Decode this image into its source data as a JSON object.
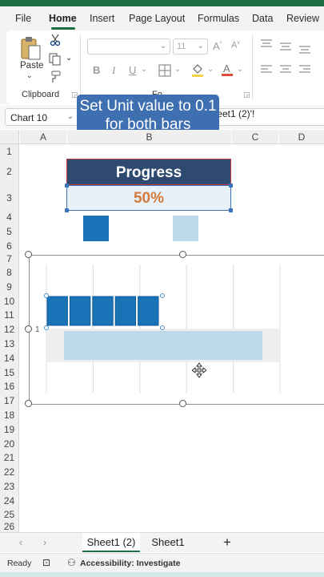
{
  "ribbon_tabs": [
    "File",
    "Home",
    "Insert",
    "Page Layout",
    "Formulas",
    "Data",
    "Review"
  ],
  "active_tab": "Home",
  "clipboard": {
    "paste_label": "Paste",
    "group_label": "Clipboard"
  },
  "font": {
    "size": "11",
    "group_label_partial": "Fo"
  },
  "name_box": "Chart 10",
  "formula_fragment": "t1 (2)'!$B$2,,'Sheet1 (2)'!",
  "caption": {
    "line1": "Set Unit value to 0.1",
    "line2": "for both bars"
  },
  "columns": [
    "A",
    "B",
    "C",
    "D"
  ],
  "rows": [
    "1",
    "2",
    "3",
    "4",
    "5",
    "6",
    "7",
    "8",
    "9",
    "10",
    "11",
    "12",
    "13",
    "14",
    "15",
    "16",
    "17",
    "18",
    "19",
    "20",
    "21",
    "22",
    "23",
    "24",
    "25",
    "26"
  ],
  "cells": {
    "progress_label": "Progress",
    "progress_value": "50%"
  },
  "chart_data": {
    "type": "bar",
    "categories": [
      "1"
    ],
    "series": [
      {
        "values": [
          0.5
        ],
        "color": "#1a73b7",
        "unit": 0.1,
        "segments": 5
      },
      {
        "values": [
          1.0
        ],
        "color": "#bcd9ec"
      }
    ],
    "xlim": [
      0,
      1.0
    ]
  },
  "colors": {
    "excel_green": "#1d6f42",
    "progress_dark": "#2e4a70",
    "bar_dark": "#1a73b7",
    "bar_light": "#bcd9ec",
    "caption_bg": "#3e6fb1",
    "pct_text": "#d27b3c"
  },
  "sheets": [
    {
      "name": "Sheet1 (2)",
      "active": true
    },
    {
      "name": "Sheet1",
      "active": false
    }
  ],
  "status": {
    "ready": "Ready",
    "accessibility": "Accessibility: Investigate"
  }
}
